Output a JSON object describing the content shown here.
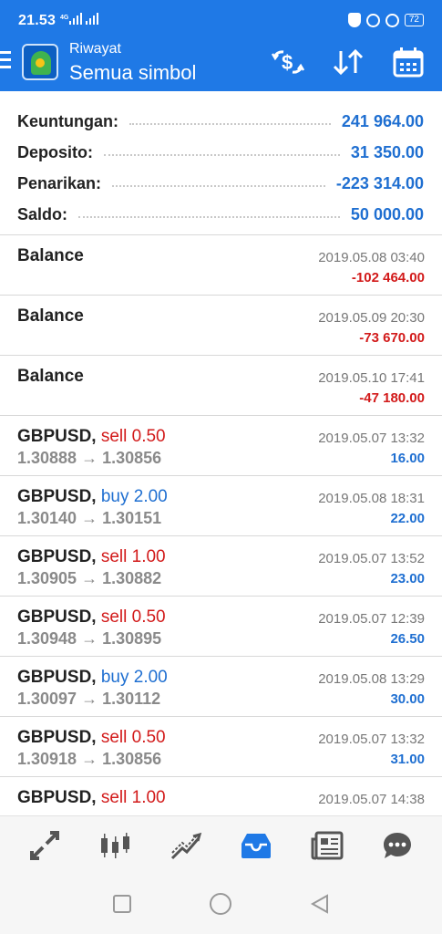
{
  "status": {
    "time": "21.53",
    "signal": "4G",
    "battery": "72"
  },
  "header": {
    "small_title": "Riwayat",
    "big_title": "Semua simbol"
  },
  "summary": [
    {
      "label": "Keuntungan:",
      "value": "241 964.00"
    },
    {
      "label": "Deposito:",
      "value": "31 350.00"
    },
    {
      "label": "Penarikan:",
      "value": "-223 314.00"
    },
    {
      "label": "Saldo:",
      "value": "50 000.00"
    }
  ],
  "rows": [
    {
      "symbol": "Balance",
      "type": "",
      "prices": "",
      "date": "2019.05.08 03:40",
      "amount": "-102 464.00"
    },
    {
      "symbol": "Balance",
      "type": "",
      "prices": "",
      "date": "2019.05.09 20:30",
      "amount": "-73 670.00"
    },
    {
      "symbol": "Balance",
      "type": "",
      "prices": "",
      "date": "2019.05.10 17:41",
      "amount": "-47 180.00"
    },
    {
      "symbol": "GBPUSD,",
      "type": "sell 0.50",
      "prices": "1.30888 → 1.30856",
      "date": "2019.05.07 13:32",
      "amount": "16.00"
    },
    {
      "symbol": "GBPUSD,",
      "type": "buy 2.00",
      "prices": "1.30140 → 1.30151",
      "date": "2019.05.08 18:31",
      "amount": "22.00"
    },
    {
      "symbol": "GBPUSD,",
      "type": "sell 1.00",
      "prices": "1.30905 → 1.30882",
      "date": "2019.05.07 13:52",
      "amount": "23.00"
    },
    {
      "symbol": "GBPUSD,",
      "type": "sell 0.50",
      "prices": "1.30948 → 1.30895",
      "date": "2019.05.07 12:39",
      "amount": "26.50"
    },
    {
      "symbol": "GBPUSD,",
      "type": "buy 2.00",
      "prices": "1.30097 → 1.30112",
      "date": "2019.05.08 13:29",
      "amount": "30.00"
    },
    {
      "symbol": "GBPUSD,",
      "type": "sell 0.50",
      "prices": "1.30918 → 1.30856",
      "date": "2019.05.07 13:32",
      "amount": "31.00"
    },
    {
      "symbol": "GBPUSD,",
      "type": "sell 1.00",
      "prices": "",
      "date": "2019.05.07 14:38",
      "amount": ""
    }
  ],
  "icons": {
    "menu": "hamburger-icon",
    "currency_exchange": "currency-exchange-icon",
    "sort": "sort-arrows-icon",
    "calendar": "calendar-icon",
    "nav": [
      "quotes-icon",
      "chart-candles-icon",
      "trade-icon",
      "history-inbox-icon",
      "news-icon",
      "chat-icon"
    ]
  },
  "colors": {
    "appbar": "#1f79e6",
    "sell": "#d21a1a",
    "buy": "#1f6fd1",
    "active_nav": "#1f79e6"
  }
}
